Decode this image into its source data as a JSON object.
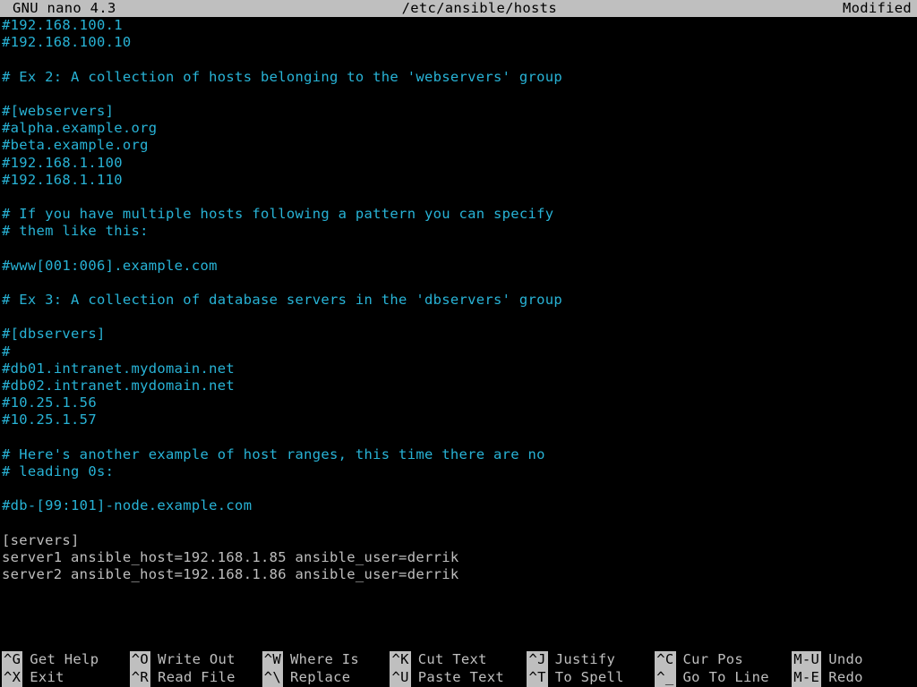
{
  "titlebar": {
    "app": "GNU nano 4.3",
    "path": "/etc/ansible/hosts",
    "status": "Modified"
  },
  "lines": [
    {
      "cls": "comment",
      "text": "#192.168.100.1"
    },
    {
      "cls": "comment",
      "text": "#192.168.100.10"
    },
    {
      "cls": "comment",
      "text": ""
    },
    {
      "cls": "comment",
      "text": "# Ex 2: A collection of hosts belonging to the 'webservers' group"
    },
    {
      "cls": "comment",
      "text": ""
    },
    {
      "cls": "comment",
      "text": "#[webservers]"
    },
    {
      "cls": "comment",
      "text": "#alpha.example.org"
    },
    {
      "cls": "comment",
      "text": "#beta.example.org"
    },
    {
      "cls": "comment",
      "text": "#192.168.1.100"
    },
    {
      "cls": "comment",
      "text": "#192.168.1.110"
    },
    {
      "cls": "comment",
      "text": ""
    },
    {
      "cls": "comment",
      "text": "# If you have multiple hosts following a pattern you can specify"
    },
    {
      "cls": "comment",
      "text": "# them like this:"
    },
    {
      "cls": "comment",
      "text": ""
    },
    {
      "cls": "comment",
      "text": "#www[001:006].example.com"
    },
    {
      "cls": "comment",
      "text": ""
    },
    {
      "cls": "comment",
      "text": "# Ex 3: A collection of database servers in the 'dbservers' group"
    },
    {
      "cls": "comment",
      "text": ""
    },
    {
      "cls": "comment",
      "text": "#[dbservers]"
    },
    {
      "cls": "comment",
      "text": "#"
    },
    {
      "cls": "comment",
      "text": "#db01.intranet.mydomain.net"
    },
    {
      "cls": "comment",
      "text": "#db02.intranet.mydomain.net"
    },
    {
      "cls": "comment",
      "text": "#10.25.1.56"
    },
    {
      "cls": "comment",
      "text": "#10.25.1.57"
    },
    {
      "cls": "comment",
      "text": ""
    },
    {
      "cls": "comment",
      "text": "# Here's another example of host ranges, this time there are no"
    },
    {
      "cls": "comment",
      "text": "# leading 0s:"
    },
    {
      "cls": "comment",
      "text": ""
    },
    {
      "cls": "comment",
      "text": "#db-[99:101]-node.example.com"
    },
    {
      "cls": "plain",
      "text": ""
    },
    {
      "cls": "plain",
      "text": "[servers]"
    },
    {
      "cls": "plain",
      "text": "server1 ansible_host=192.168.1.85 ansible_user=derrik"
    },
    {
      "cls": "plain",
      "text": "server2 ansible_host=192.168.1.86 ansible_user=derrik"
    }
  ],
  "help": [
    {
      "key": "^G",
      "label": "Get Help"
    },
    {
      "key": "^O",
      "label": "Write Out"
    },
    {
      "key": "^W",
      "label": "Where Is"
    },
    {
      "key": "^K",
      "label": "Cut Text"
    },
    {
      "key": "^J",
      "label": "Justify"
    },
    {
      "key": "^C",
      "label": "Cur Pos"
    },
    {
      "key": "M-U",
      "label": "Undo"
    },
    {
      "key": "^X",
      "label": "Exit"
    },
    {
      "key": "^R",
      "label": "Read File"
    },
    {
      "key": "^\\",
      "label": "Replace"
    },
    {
      "key": "^U",
      "label": "Paste Text"
    },
    {
      "key": "^T",
      "label": "To Spell"
    },
    {
      "key": "^_",
      "label": "Go To Line"
    },
    {
      "key": "M-E",
      "label": "Redo"
    }
  ]
}
